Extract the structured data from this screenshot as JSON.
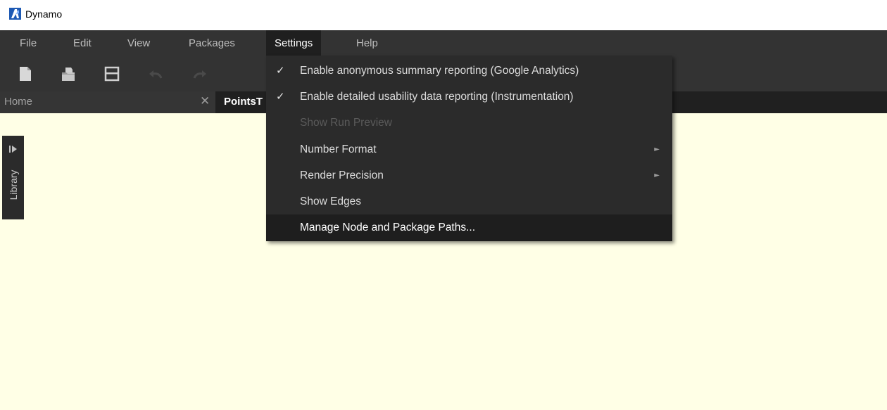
{
  "window": {
    "title": "Dynamo",
    "logo_icon": "dynamo-logo-icon",
    "logo_color": "#1e5ab4"
  },
  "menubar": {
    "items": [
      {
        "label": "File"
      },
      {
        "label": "Edit"
      },
      {
        "label": "View"
      },
      {
        "label": "Packages"
      },
      {
        "label": "Settings"
      },
      {
        "label": "Help"
      }
    ],
    "active": "Settings"
  },
  "toolbar": {
    "buttons": [
      {
        "icon": "new-file-icon",
        "enabled": true
      },
      {
        "icon": "open-folder-icon",
        "enabled": true
      },
      {
        "icon": "save-icon",
        "enabled": true
      },
      {
        "icon": "undo-icon",
        "enabled": false
      },
      {
        "icon": "redo-icon",
        "enabled": false
      }
    ]
  },
  "tabs": {
    "home": {
      "label": "Home",
      "close_icon": "close-icon"
    },
    "workspace": {
      "label": "PointsT"
    }
  },
  "library": {
    "label": "Library",
    "expand_icon": "expand-arrow-icon"
  },
  "settings_menu": {
    "items": [
      {
        "label": "Enable anonymous summary reporting (Google Analytics)",
        "checked": true,
        "enabled": true,
        "submenu": false
      },
      {
        "label": "Enable detailed usability data reporting (Instrumentation)",
        "checked": true,
        "enabled": true,
        "submenu": false
      },
      {
        "label": "Show Run Preview",
        "checked": false,
        "enabled": false,
        "submenu": false
      },
      {
        "label": "Number Format",
        "checked": false,
        "enabled": true,
        "submenu": true
      },
      {
        "label": "Render Precision",
        "checked": false,
        "enabled": true,
        "submenu": true
      },
      {
        "label": "Show Edges",
        "checked": false,
        "enabled": true,
        "submenu": false
      },
      {
        "label": "Manage Node and Package Paths...",
        "checked": false,
        "enabled": true,
        "submenu": false,
        "highlighted": true
      }
    ],
    "check_glyph": "✓",
    "submenu_glyph": "►"
  },
  "colors": {
    "menubar_bg": "#333333",
    "canvas_bg": "#ffffe6",
    "dropdown_bg": "#2b2b2b"
  }
}
